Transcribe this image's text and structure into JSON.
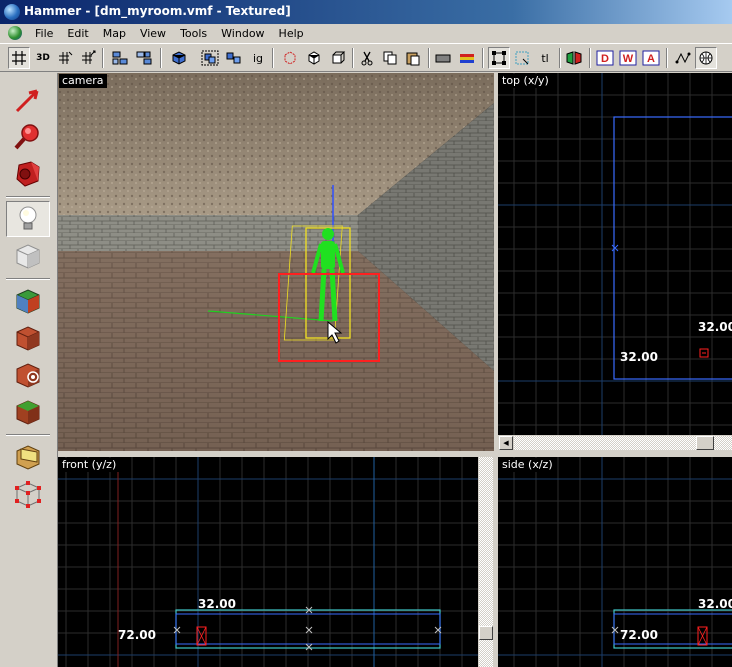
{
  "window": {
    "title": "Hammer - [dm_myroom.vmf - Textured]"
  },
  "menu": [
    "File",
    "Edit",
    "Map",
    "View",
    "Tools",
    "Window",
    "Help"
  ],
  "toolbar": {
    "text_buttons": {
      "threed": "3D",
      "ig": "ig",
      "tl": "tl"
    }
  },
  "viewports": {
    "camera": {
      "label": "camera"
    },
    "top": {
      "label": "top (x/y)",
      "dim_width": "32.00",
      "dim_height": "32.00"
    },
    "front": {
      "label": "front (y/z)",
      "dim_width": "32.00",
      "dim_height": "72.00"
    },
    "side": {
      "label": "side (x/z)",
      "dim_width": "32.00",
      "dim_height": "72.00"
    }
  },
  "colors": {
    "grid": "#2c2c2c",
    "grid_major": "#1c3e6a",
    "selection": "#ff2020",
    "brush_blue": "#3a6cff",
    "brush_cyan": "#40c8c8",
    "entity_green": "#20e020"
  }
}
